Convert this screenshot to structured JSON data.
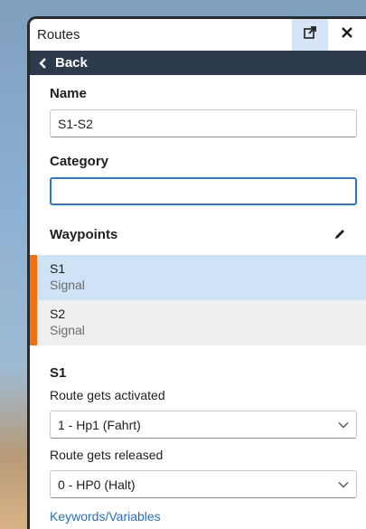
{
  "window": {
    "title": "Routes",
    "popout_icon": "popout-icon",
    "close_icon": "close-icon"
  },
  "nav": {
    "back_label": "Back",
    "back_icon": "chevron-left-icon"
  },
  "form": {
    "name_label": "Name",
    "name_value": "S1-S2",
    "category_label": "Category",
    "category_value": ""
  },
  "waypoints": {
    "header": "Waypoints",
    "edit_icon": "pencil-icon",
    "items": [
      {
        "name": "S1",
        "type": "Signal",
        "selected": true
      },
      {
        "name": "S2",
        "type": "Signal",
        "selected": false
      }
    ]
  },
  "detail": {
    "title": "S1",
    "activated_label": "Route gets activated",
    "activated_value": "1 - Hp1 (Fahrt)",
    "released_label": "Route gets released",
    "released_value": "0 - HP0 (Halt)",
    "keywords_link": "Keywords/Variables"
  },
  "colors": {
    "accent": "#2a79d2",
    "backbar": "#2d3a4b",
    "marker": "#ee7214",
    "selected_row": "#cfe3f7",
    "link": "#2a6ebe"
  }
}
